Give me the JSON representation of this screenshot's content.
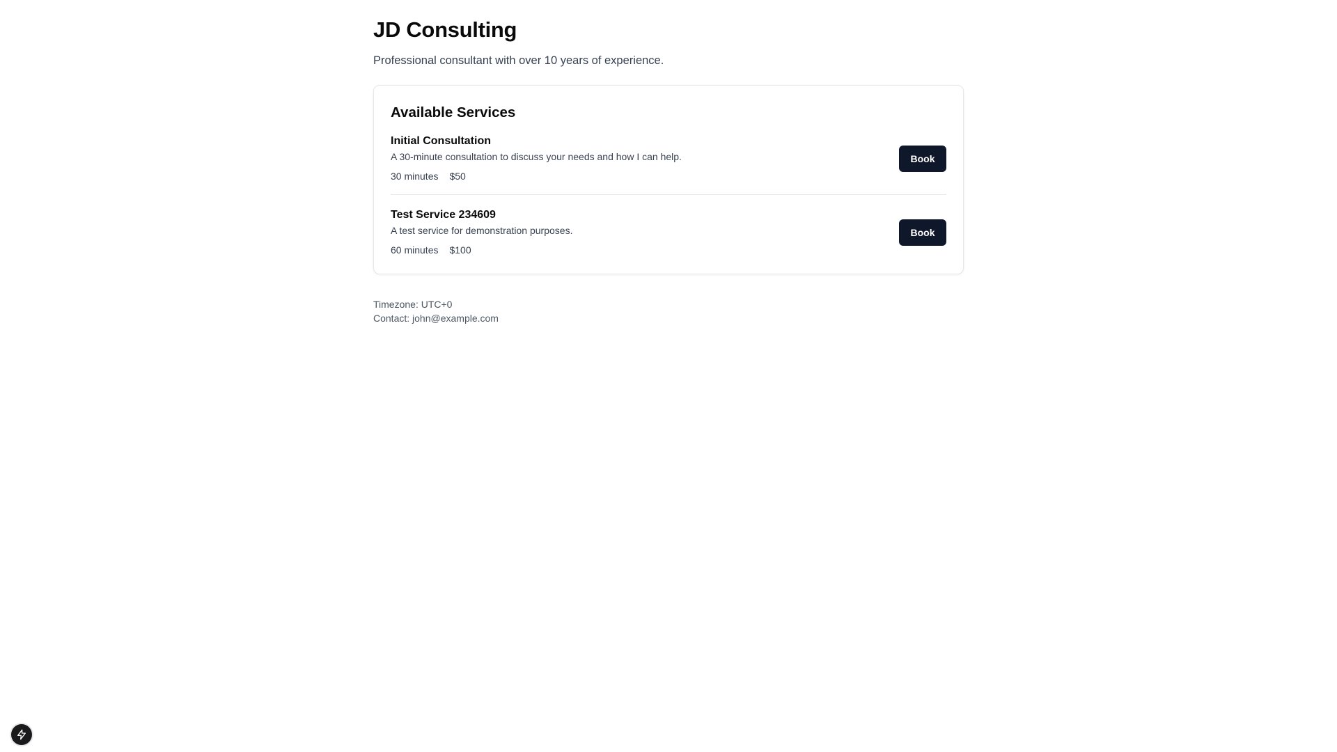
{
  "header": {
    "title": "JD Consulting",
    "subtitle": "Professional consultant with over 10 years of experience."
  },
  "services_card": {
    "title": "Available Services",
    "services": [
      {
        "name": "Initial Consultation",
        "description": "A 30-minute consultation to discuss your needs and how I can help.",
        "duration": "30 minutes",
        "price": "$50",
        "book_label": "Book"
      },
      {
        "name": "Test Service 234609",
        "description": "A test service for demonstration purposes.",
        "duration": "60 minutes",
        "price": "$100",
        "book_label": "Book"
      }
    ]
  },
  "footer": {
    "timezone": "Timezone: UTC+0",
    "contact": "Contact: john@example.com"
  },
  "floating_button": {
    "icon": "bolt-icon"
  },
  "colors": {
    "button_bg": "#0f172a",
    "text_primary": "#0a0a0a",
    "text_secondary": "#374151",
    "border": "#e5e7eb"
  }
}
